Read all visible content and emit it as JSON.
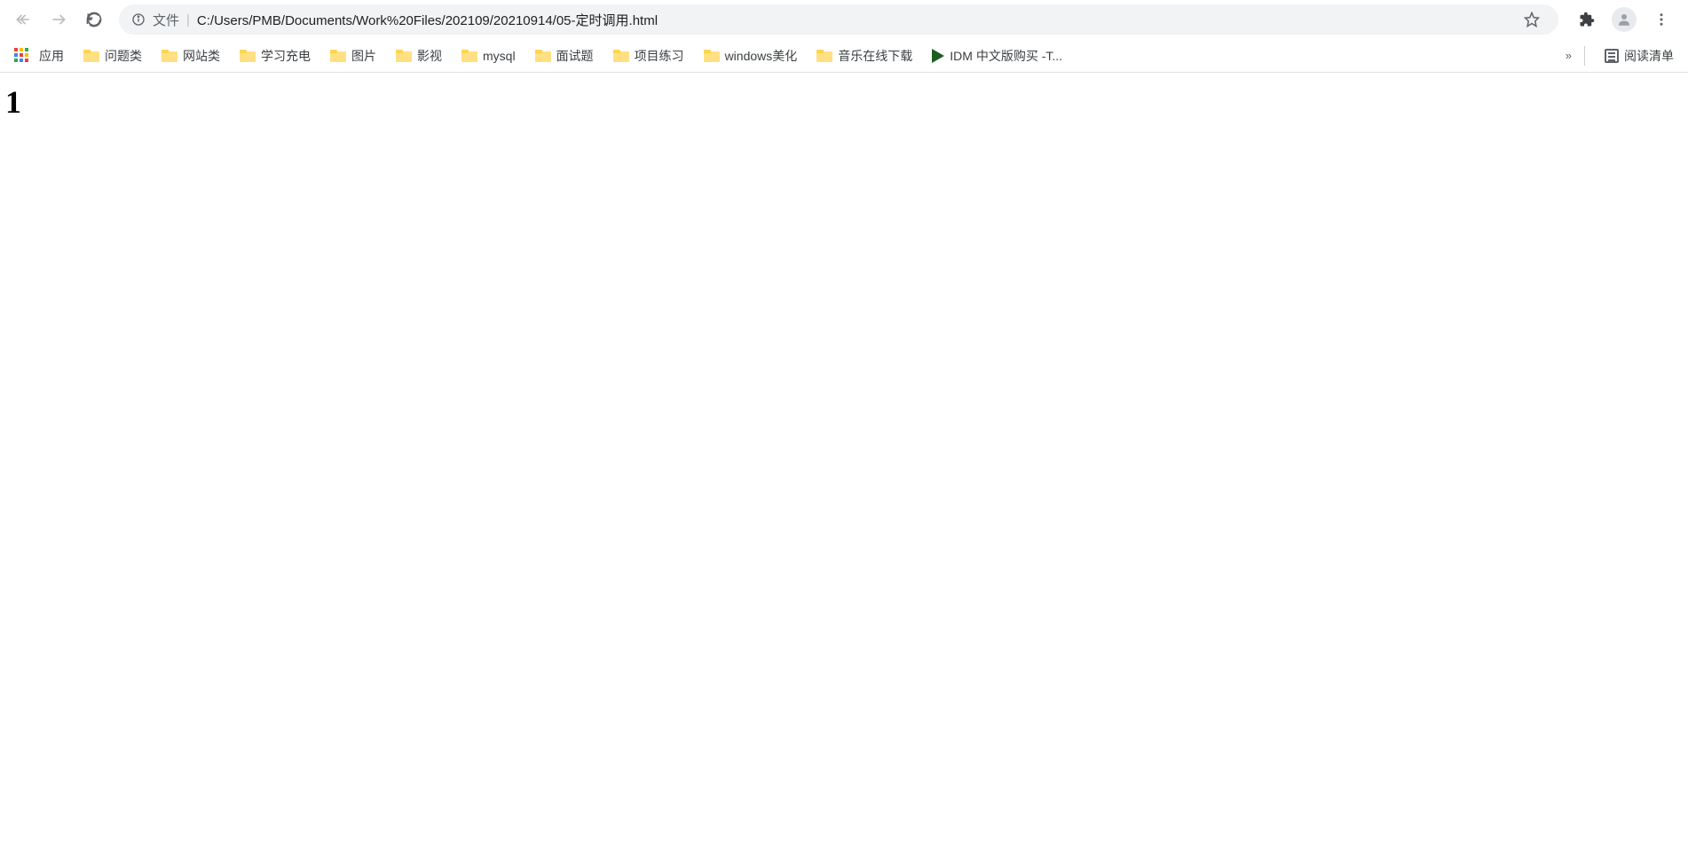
{
  "toolbar": {
    "url_prefix": "文件",
    "url": "C:/Users/PMB/Documents/Work%20Files/202109/20210914/05-定时调用.html"
  },
  "bookmarks": {
    "apps_label": "应用",
    "items": [
      {
        "type": "folder",
        "label": "问题类"
      },
      {
        "type": "folder",
        "label": "网站类"
      },
      {
        "type": "folder",
        "label": "学习充电"
      },
      {
        "type": "folder",
        "label": "图片"
      },
      {
        "type": "folder",
        "label": "影视"
      },
      {
        "type": "folder",
        "label": "mysql"
      },
      {
        "type": "folder",
        "label": "面试题"
      },
      {
        "type": "folder",
        "label": "项目练习"
      },
      {
        "type": "folder",
        "label": "windows美化"
      },
      {
        "type": "folder",
        "label": "音乐在线下载"
      },
      {
        "type": "link",
        "label": "IDM 中文版购买 -T..."
      }
    ],
    "overflow": "»",
    "reading_list": "阅读清单"
  },
  "page": {
    "heading": "1"
  }
}
